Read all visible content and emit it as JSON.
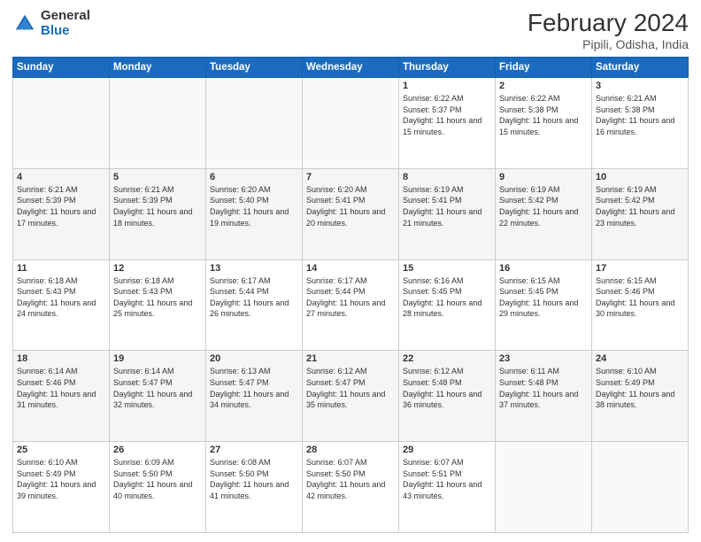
{
  "header": {
    "logo_general": "General",
    "logo_blue": "Blue",
    "month_title": "February 2024",
    "location": "Pipili, Odisha, India"
  },
  "days_of_week": [
    "Sunday",
    "Monday",
    "Tuesday",
    "Wednesday",
    "Thursday",
    "Friday",
    "Saturday"
  ],
  "weeks": [
    [
      {
        "day": "",
        "sunrise": "",
        "sunset": "",
        "daylight": "",
        "empty": true
      },
      {
        "day": "",
        "sunrise": "",
        "sunset": "",
        "daylight": "",
        "empty": true
      },
      {
        "day": "",
        "sunrise": "",
        "sunset": "",
        "daylight": "",
        "empty": true
      },
      {
        "day": "",
        "sunrise": "",
        "sunset": "",
        "daylight": "",
        "empty": true
      },
      {
        "day": "1",
        "sunrise": "Sunrise: 6:22 AM",
        "sunset": "Sunset: 5:37 PM",
        "daylight": "Daylight: 11 hours and 15 minutes.",
        "empty": false
      },
      {
        "day": "2",
        "sunrise": "Sunrise: 6:22 AM",
        "sunset": "Sunset: 5:38 PM",
        "daylight": "Daylight: 11 hours and 15 minutes.",
        "empty": false
      },
      {
        "day": "3",
        "sunrise": "Sunrise: 6:21 AM",
        "sunset": "Sunset: 5:38 PM",
        "daylight": "Daylight: 11 hours and 16 minutes.",
        "empty": false
      }
    ],
    [
      {
        "day": "4",
        "sunrise": "Sunrise: 6:21 AM",
        "sunset": "Sunset: 5:39 PM",
        "daylight": "Daylight: 11 hours and 17 minutes.",
        "empty": false
      },
      {
        "day": "5",
        "sunrise": "Sunrise: 6:21 AM",
        "sunset": "Sunset: 5:39 PM",
        "daylight": "Daylight: 11 hours and 18 minutes.",
        "empty": false
      },
      {
        "day": "6",
        "sunrise": "Sunrise: 6:20 AM",
        "sunset": "Sunset: 5:40 PM",
        "daylight": "Daylight: 11 hours and 19 minutes.",
        "empty": false
      },
      {
        "day": "7",
        "sunrise": "Sunrise: 6:20 AM",
        "sunset": "Sunset: 5:41 PM",
        "daylight": "Daylight: 11 hours and 20 minutes.",
        "empty": false
      },
      {
        "day": "8",
        "sunrise": "Sunrise: 6:19 AM",
        "sunset": "Sunset: 5:41 PM",
        "daylight": "Daylight: 11 hours and 21 minutes.",
        "empty": false
      },
      {
        "day": "9",
        "sunrise": "Sunrise: 6:19 AM",
        "sunset": "Sunset: 5:42 PM",
        "daylight": "Daylight: 11 hours and 22 minutes.",
        "empty": false
      },
      {
        "day": "10",
        "sunrise": "Sunrise: 6:19 AM",
        "sunset": "Sunset: 5:42 PM",
        "daylight": "Daylight: 11 hours and 23 minutes.",
        "empty": false
      }
    ],
    [
      {
        "day": "11",
        "sunrise": "Sunrise: 6:18 AM",
        "sunset": "Sunset: 5:43 PM",
        "daylight": "Daylight: 11 hours and 24 minutes.",
        "empty": false
      },
      {
        "day": "12",
        "sunrise": "Sunrise: 6:18 AM",
        "sunset": "Sunset: 5:43 PM",
        "daylight": "Daylight: 11 hours and 25 minutes.",
        "empty": false
      },
      {
        "day": "13",
        "sunrise": "Sunrise: 6:17 AM",
        "sunset": "Sunset: 5:44 PM",
        "daylight": "Daylight: 11 hours and 26 minutes.",
        "empty": false
      },
      {
        "day": "14",
        "sunrise": "Sunrise: 6:17 AM",
        "sunset": "Sunset: 5:44 PM",
        "daylight": "Daylight: 11 hours and 27 minutes.",
        "empty": false
      },
      {
        "day": "15",
        "sunrise": "Sunrise: 6:16 AM",
        "sunset": "Sunset: 5:45 PM",
        "daylight": "Daylight: 11 hours and 28 minutes.",
        "empty": false
      },
      {
        "day": "16",
        "sunrise": "Sunrise: 6:15 AM",
        "sunset": "Sunset: 5:45 PM",
        "daylight": "Daylight: 11 hours and 29 minutes.",
        "empty": false
      },
      {
        "day": "17",
        "sunrise": "Sunrise: 6:15 AM",
        "sunset": "Sunset: 5:46 PM",
        "daylight": "Daylight: 11 hours and 30 minutes.",
        "empty": false
      }
    ],
    [
      {
        "day": "18",
        "sunrise": "Sunrise: 6:14 AM",
        "sunset": "Sunset: 5:46 PM",
        "daylight": "Daylight: 11 hours and 31 minutes.",
        "empty": false
      },
      {
        "day": "19",
        "sunrise": "Sunrise: 6:14 AM",
        "sunset": "Sunset: 5:47 PM",
        "daylight": "Daylight: 11 hours and 32 minutes.",
        "empty": false
      },
      {
        "day": "20",
        "sunrise": "Sunrise: 6:13 AM",
        "sunset": "Sunset: 5:47 PM",
        "daylight": "Daylight: 11 hours and 34 minutes.",
        "empty": false
      },
      {
        "day": "21",
        "sunrise": "Sunrise: 6:12 AM",
        "sunset": "Sunset: 5:47 PM",
        "daylight": "Daylight: 11 hours and 35 minutes.",
        "empty": false
      },
      {
        "day": "22",
        "sunrise": "Sunrise: 6:12 AM",
        "sunset": "Sunset: 5:48 PM",
        "daylight": "Daylight: 11 hours and 36 minutes.",
        "empty": false
      },
      {
        "day": "23",
        "sunrise": "Sunrise: 6:11 AM",
        "sunset": "Sunset: 5:48 PM",
        "daylight": "Daylight: 11 hours and 37 minutes.",
        "empty": false
      },
      {
        "day": "24",
        "sunrise": "Sunrise: 6:10 AM",
        "sunset": "Sunset: 5:49 PM",
        "daylight": "Daylight: 11 hours and 38 minutes.",
        "empty": false
      }
    ],
    [
      {
        "day": "25",
        "sunrise": "Sunrise: 6:10 AM",
        "sunset": "Sunset: 5:49 PM",
        "daylight": "Daylight: 11 hours and 39 minutes.",
        "empty": false
      },
      {
        "day": "26",
        "sunrise": "Sunrise: 6:09 AM",
        "sunset": "Sunset: 5:50 PM",
        "daylight": "Daylight: 11 hours and 40 minutes.",
        "empty": false
      },
      {
        "day": "27",
        "sunrise": "Sunrise: 6:08 AM",
        "sunset": "Sunset: 5:50 PM",
        "daylight": "Daylight: 11 hours and 41 minutes.",
        "empty": false
      },
      {
        "day": "28",
        "sunrise": "Sunrise: 6:07 AM",
        "sunset": "Sunset: 5:50 PM",
        "daylight": "Daylight: 11 hours and 42 minutes.",
        "empty": false
      },
      {
        "day": "29",
        "sunrise": "Sunrise: 6:07 AM",
        "sunset": "Sunset: 5:51 PM",
        "daylight": "Daylight: 11 hours and 43 minutes.",
        "empty": false
      },
      {
        "day": "",
        "sunrise": "",
        "sunset": "",
        "daylight": "",
        "empty": true
      },
      {
        "day": "",
        "sunrise": "",
        "sunset": "",
        "daylight": "",
        "empty": true
      }
    ]
  ]
}
